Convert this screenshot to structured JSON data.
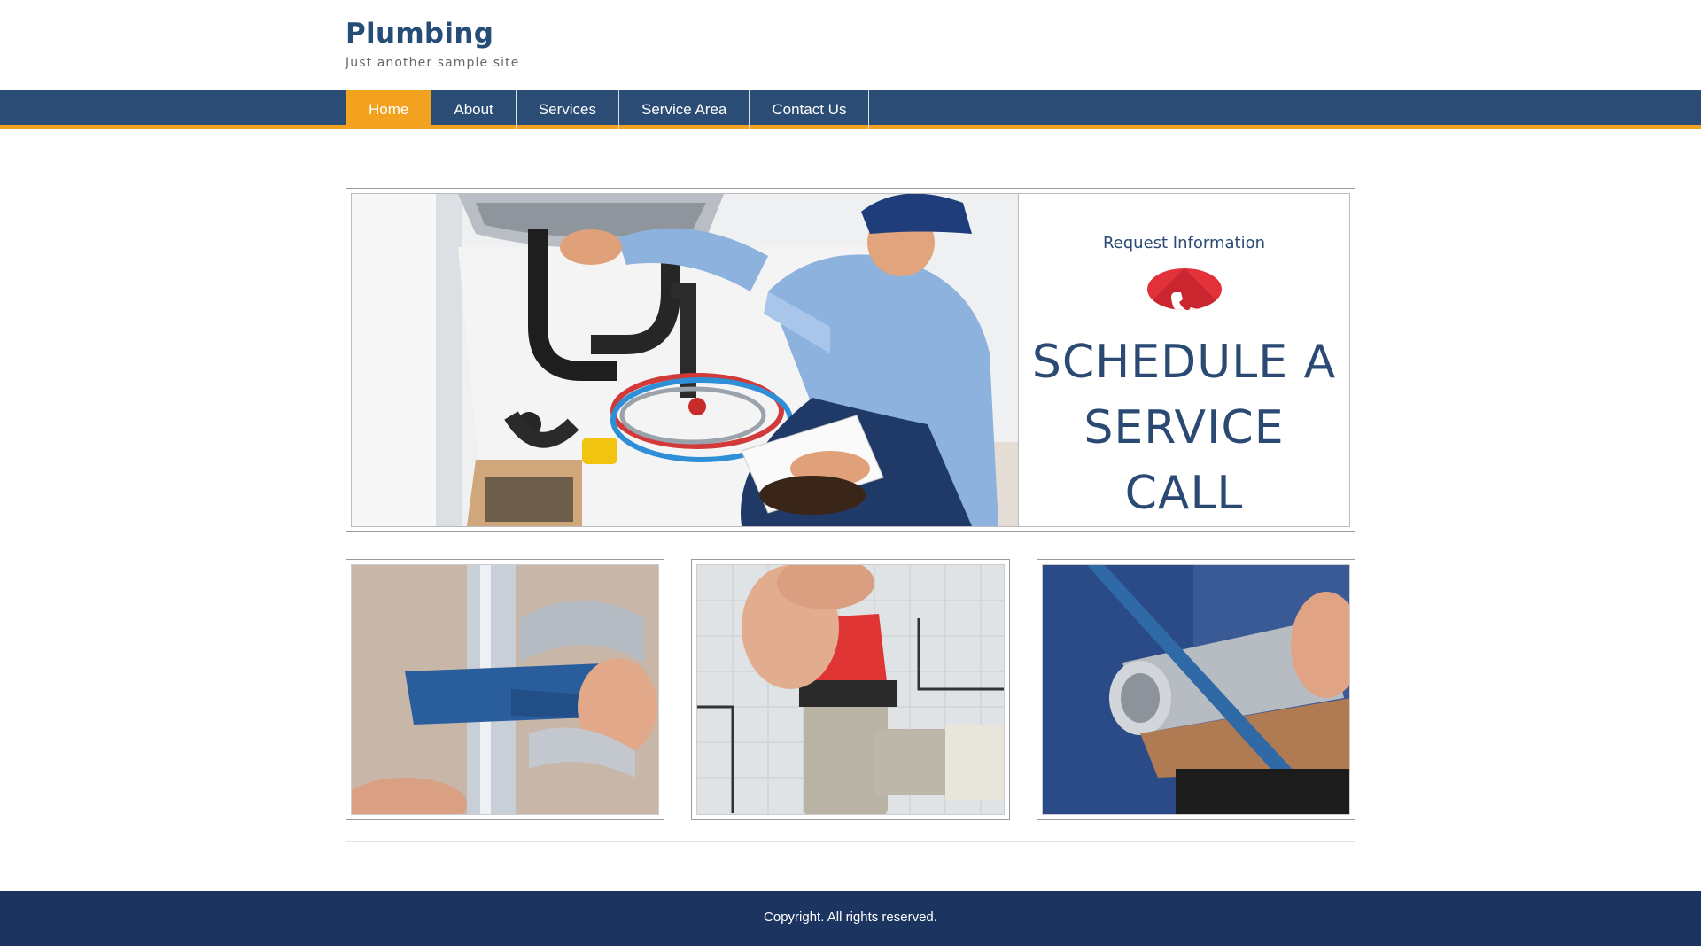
{
  "site": {
    "title": "Plumbing",
    "tagline": "Just another sample site"
  },
  "nav": {
    "items": [
      {
        "label": "Home",
        "active": true
      },
      {
        "label": "About",
        "active": false
      },
      {
        "label": "Services",
        "active": false
      },
      {
        "label": "Service Area",
        "active": false
      },
      {
        "label": "Contact Us",
        "active": false
      }
    ]
  },
  "hero": {
    "image_icon": "plumber-under-sink-photo",
    "request_label": "Request Information",
    "phone_icon": "phone-icon",
    "title_line1": "SCHEDULE A",
    "title_line2": "SERVICE CALL"
  },
  "cards": [
    {
      "image_icon": "wrench-on-pipe-photo"
    },
    {
      "image_icon": "red-valve-photo"
    },
    {
      "image_icon": "pipe-cutting-photo"
    }
  ],
  "footer": {
    "copyright": "Copyright. All rights reserved."
  },
  "colors": {
    "brand_blue": "#2b4c74",
    "accent_orange": "#f3a21f",
    "footer_navy": "#1c3560",
    "phone_red": "#e3313a"
  }
}
